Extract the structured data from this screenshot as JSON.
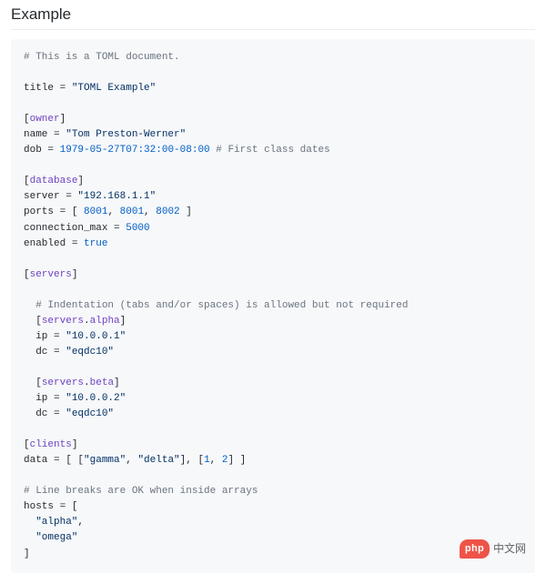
{
  "heading": "Example",
  "code": {
    "l1": "# This is a TOML document.",
    "l3a": "title",
    "l3b": " = ",
    "l3c": "\"TOML Example\"",
    "l5a": "[",
    "l5b": "owner",
    "l5c": "]",
    "l6a": "name",
    "l6b": " = ",
    "l6c": "\"Tom Preston-Werner\"",
    "l7a": "dob",
    "l7b": " = ",
    "l7c": "1979-05-27T07:32:00-08:00",
    "l7d": " # First class dates",
    "l9a": "[",
    "l9b": "database",
    "l9c": "]",
    "l10a": "server",
    "l10b": " = ",
    "l10c": "\"192.168.1.1\"",
    "l11a": "ports",
    "l11b": " = [ ",
    "l11c": "8001",
    "l11d": ", ",
    "l11e": "8001",
    "l11f": ", ",
    "l11g": "8002",
    "l11h": " ]",
    "l12a": "connection_max",
    "l12b": " = ",
    "l12c": "5000",
    "l13a": "enabled",
    "l13b": " = ",
    "l13c": "true",
    "l15a": "[",
    "l15b": "servers",
    "l15c": "]",
    "l17": "  # Indentation (tabs and/or spaces) is allowed but not required",
    "l18a": "  [",
    "l18b": "servers",
    "l18c": ".",
    "l18d": "alpha",
    "l18e": "]",
    "l19a": "  ip",
    "l19b": " = ",
    "l19c": "\"10.0.0.1\"",
    "l20a": "  dc",
    "l20b": " = ",
    "l20c": "\"eqdc10\"",
    "l22a": "  [",
    "l22b": "servers",
    "l22c": ".",
    "l22d": "beta",
    "l22e": "]",
    "l23a": "  ip",
    "l23b": " = ",
    "l23c": "\"10.0.0.2\"",
    "l24a": "  dc",
    "l24b": " = ",
    "l24c": "\"eqdc10\"",
    "l26a": "[",
    "l26b": "clients",
    "l26c": "]",
    "l27a": "data",
    "l27b": " = [ [",
    "l27c": "\"gamma\"",
    "l27d": ", ",
    "l27e": "\"delta\"",
    "l27f": "], [",
    "l27g": "1",
    "l27h": ", ",
    "l27i": "2",
    "l27j": "] ]",
    "l29": "# Line breaks are OK when inside arrays",
    "l30a": "hosts",
    "l30b": " = [",
    "l31a": "  ",
    "l31b": "\"alpha\"",
    "l31c": ",",
    "l32a": "  ",
    "l32b": "\"omega\"",
    "l33": "]"
  },
  "watermark": {
    "badge": "php",
    "text": "中文网"
  }
}
